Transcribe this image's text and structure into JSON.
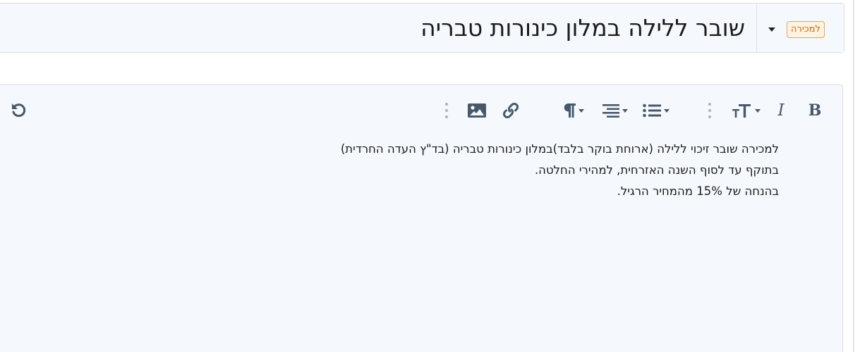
{
  "thread": {
    "prefix": "למכירה",
    "title": "שובר ללילה במלון כינורות טבריה"
  },
  "toolbar": {
    "buttons": [
      {
        "name": "bold",
        "icon": "bold-icon",
        "glyph": "B"
      },
      {
        "name": "italic",
        "icon": "italic-icon",
        "glyph": "I"
      },
      {
        "name": "text-size",
        "icon": "text-size-icon"
      },
      {
        "name": "more-text-options",
        "icon": "vertical-ellipsis-icon"
      },
      {
        "name": "list",
        "icon": "list-icon"
      },
      {
        "name": "align",
        "icon": "align-icon"
      },
      {
        "name": "paragraph",
        "icon": "paragraph-icon"
      },
      {
        "name": "link",
        "icon": "link-icon"
      },
      {
        "name": "image",
        "icon": "image-icon"
      },
      {
        "name": "more-insert-options",
        "icon": "vertical-ellipsis-icon"
      },
      {
        "name": "undo",
        "icon": "undo-icon"
      }
    ]
  },
  "body": {
    "lines": [
      "למכירה שובר זיכוי ללילה  (ארוחת בוקר בלבד)במלון כינורות טבריה (בד\"ץ העדה החרדית)",
      "בתוקף עד לסוף השנה האזרחית, למהירי החלטה.",
      "בהנחה של 15% מהמחיר הרגיל."
    ]
  },
  "colors": {
    "prefix_bg": "#fef3e0",
    "prefix_border": "#e8a653",
    "prefix_text": "#c46a0c",
    "toolbar_icon": "#47586b",
    "panel_bg": "#f5f8fc"
  }
}
